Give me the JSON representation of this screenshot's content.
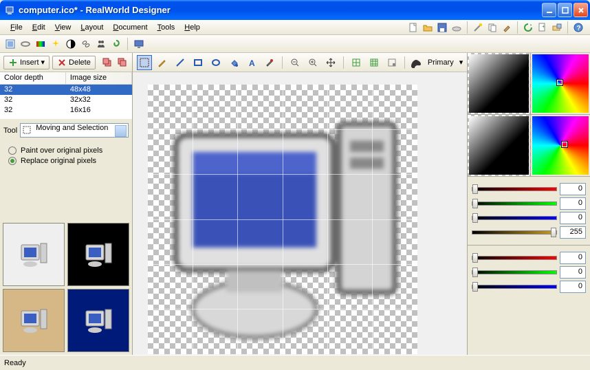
{
  "title": "computer.ico* - RealWorld Designer",
  "menu": [
    "File",
    "Edit",
    "View",
    "Layout",
    "Document",
    "Tools",
    "Help"
  ],
  "left": {
    "insert": "Insert",
    "delete": "Delete",
    "headers": {
      "depth": "Color depth",
      "size": "Image size"
    },
    "rows": [
      {
        "depth": "32",
        "size": "48x48",
        "selected": true
      },
      {
        "depth": "32",
        "size": "32x32",
        "selected": false
      },
      {
        "depth": "32",
        "size": "16x16",
        "selected": false
      }
    ],
    "tool_label": "Tool",
    "tool_value": "Moving and Selection",
    "radio1": "Paint over original pixels",
    "radio2": "Replace original pixels"
  },
  "canvas_tb": {
    "primary": "Primary"
  },
  "sliders1": [
    {
      "color": "red",
      "val": "0",
      "pos": 0
    },
    {
      "color": "green",
      "val": "0",
      "pos": 0
    },
    {
      "color": "blue",
      "val": "0",
      "pos": 0
    },
    {
      "color": "alpha",
      "val": "255",
      "pos": 100
    }
  ],
  "sliders2": [
    {
      "color": "red",
      "val": "0",
      "pos": 0
    },
    {
      "color": "green",
      "val": "0",
      "pos": 0
    },
    {
      "color": "blue",
      "val": "0",
      "pos": 0
    }
  ],
  "status": "Ready"
}
